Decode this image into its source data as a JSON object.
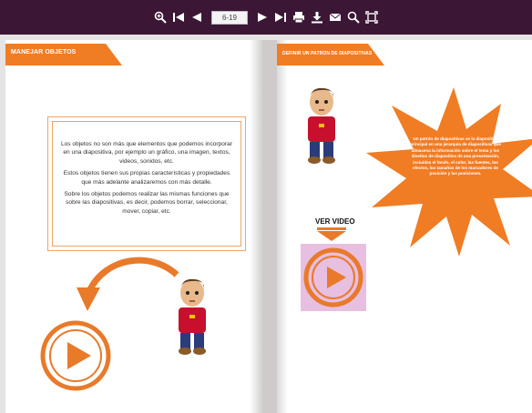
{
  "toolbar": {
    "page_indicator": "6-19",
    "icons": [
      "zoom-in-icon",
      "first-page-icon",
      "previous-page-icon",
      "next-page-icon",
      "last-page-icon",
      "print-icon",
      "download-icon",
      "email-icon",
      "search-icon",
      "fullscreen-icon"
    ]
  },
  "left_page": {
    "banner": "MANEJAR OBJETOS",
    "paragraphs": [
      "Los objetos no son más que elementos que podemos incorporar en una diapositiva, por ejemplo un gráfico, una imagen, textos, videos, sonidos, etc.",
      "Estos objetos tienen sus propias características y propiedades que más adelante analizaremos con más detalle.",
      "Sobre los objetos podemos realizar las mismas funciones que sobre las diapositivas, es decir, podemos borrar, seleccionar, mover, copiar, etc."
    ]
  },
  "right_page": {
    "banner": "DEFINIR UN PATRON DE DIAPOSITIVAS",
    "video_label": "VER VIDEO",
    "star_text": "Un patrón de diapositivas es la diapositiva principal en una jerarquía de diapositivas que almacena la información sobre el tema y los diseños de diapositiva de una presentación, incluidos el fondo, el color, las fuentes, los efectos, los tamaños de los marcadores de posición y las posiciones."
  },
  "colors": {
    "toolbar_bg": "#3b1735",
    "accent_orange": "#f07c24",
    "video_tile_bg": "#e7bfe0"
  }
}
